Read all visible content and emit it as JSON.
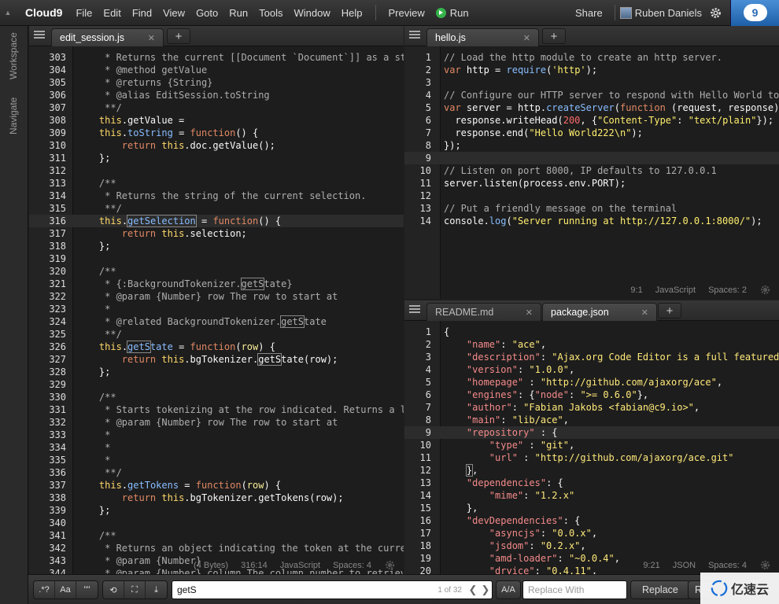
{
  "menubar": {
    "logo": "Cloud9",
    "menus": [
      "File",
      "Edit",
      "Find",
      "View",
      "Goto",
      "Run",
      "Tools",
      "Window",
      "Help"
    ],
    "preview": "Preview",
    "run": "Run",
    "share": "Share",
    "user": "Ruben Daniels",
    "badge": "9"
  },
  "sidebar": {
    "workspace": "Workspace",
    "navigate": "Navigate"
  },
  "left_pane": {
    "tab": "edit_session.js",
    "status": {
      "size": "(4 Bytes)",
      "pos": "316:14",
      "mode": "JavaScript",
      "spaces": "Spaces: 4"
    },
    "lines": [
      {
        "n": "303",
        "h": "<span class=\"c-com\">     * Returns the current [[Document `Document`]] as a string.</span>"
      },
      {
        "n": "304",
        "h": "<span class=\"c-com\">     * @method getValue</span>"
      },
      {
        "n": "305",
        "h": "<span class=\"c-com\">     * @returns {String}</span>"
      },
      {
        "n": "306",
        "h": "<span class=\"c-com\">     * @alias EditSession.toString</span>"
      },
      {
        "n": "307",
        "h": "<span class=\"c-com\">     **/</span>"
      },
      {
        "n": "308",
        "h": "    <span class=\"c-this\">this</span><span class=\"c-plain\">.getValue =</span>"
      },
      {
        "n": "309",
        "h": "    <span class=\"c-this\">this</span><span class=\"c-plain\">.</span><span class=\"c-fn\">toString</span><span class=\"c-plain\"> = </span><span class=\"c-kw\">function</span><span class=\"c-plain\">() {</span>"
      },
      {
        "n": "310",
        "h": "        <span class=\"c-kw\">return</span> <span class=\"c-this\">this</span><span class=\"c-plain\">.doc.getValue();</span>"
      },
      {
        "n": "311",
        "h": "    <span class=\"c-plain\">};</span>"
      },
      {
        "n": "312",
        "h": ""
      },
      {
        "n": "313",
        "h": "<span class=\"c-com\">    /**</span>"
      },
      {
        "n": "314",
        "h": "<span class=\"c-com\">     * Returns the string of the current selection.</span>"
      },
      {
        "n": "315",
        "h": "<span class=\"c-com\">     **/</span>"
      },
      {
        "n": "316",
        "hl": true,
        "h": "    <span class=\"c-this\">this</span><span class=\"c-plain\">.</span><span class=\"c-fn box\">getSelection</span><span class=\"c-plain\"> = </span><span class=\"c-kw\">function</span><span class=\"c-plain\">() {</span>"
      },
      {
        "n": "317",
        "h": "        <span class=\"c-kw\">return</span> <span class=\"c-this\">this</span><span class=\"c-plain\">.selection;</span>"
      },
      {
        "n": "318",
        "h": "    <span class=\"c-plain\">};</span>"
      },
      {
        "n": "319",
        "h": ""
      },
      {
        "n": "320",
        "h": "<span class=\"c-com\">    /**</span>"
      },
      {
        "n": "321",
        "h": "<span class=\"c-com\">     * {:BackgroundTokenizer.<span class=\"box\">getS</span>tate}</span>"
      },
      {
        "n": "322",
        "h": "<span class=\"c-com\">     * @param {Number} row The row to start at</span>"
      },
      {
        "n": "323",
        "h": "<span class=\"c-com\">     *</span>"
      },
      {
        "n": "324",
        "h": "<span class=\"c-com\">     * @related BackgroundTokenizer.<span class=\"box\">getS</span>tate</span>"
      },
      {
        "n": "325",
        "h": "<span class=\"c-com\">     **/</span>"
      },
      {
        "n": "326",
        "h": "    <span class=\"c-this\">this</span><span class=\"c-plain\">.</span><span class=\"c-fn box\">getS</span><span class=\"c-fn\">tate</span><span class=\"c-plain\"> = </span><span class=\"c-kw\">function</span><span class=\"c-plain\">(</span><span class=\"c-key\">row</span><span class=\"c-plain\">) {</span>"
      },
      {
        "n": "327",
        "h": "        <span class=\"c-kw\">return</span> <span class=\"c-this\">this</span><span class=\"c-plain\">.bgTokenizer.</span><span class=\"c-plain box\">getS</span><span class=\"c-plain\">tate(row);</span>"
      },
      {
        "n": "328",
        "h": "    <span class=\"c-plain\">};</span>"
      },
      {
        "n": "329",
        "h": ""
      },
      {
        "n": "330",
        "h": "<span class=\"c-com\">    /**</span>"
      },
      {
        "n": "331",
        "h": "<span class=\"c-com\">     * Starts tokenizing at the row indicated. Returns a list of</span>"
      },
      {
        "n": "332",
        "h": "<span class=\"c-com\">     * @param {Number} row The row to start at</span>"
      },
      {
        "n": "333",
        "h": "<span class=\"c-com\">     *</span>"
      },
      {
        "n": "334",
        "h": "<span class=\"c-com\">     *</span>"
      },
      {
        "n": "335",
        "h": "<span class=\"c-com\">     *</span>"
      },
      {
        "n": "336",
        "h": "<span class=\"c-com\">     **/</span>"
      },
      {
        "n": "337",
        "h": "    <span class=\"c-this\">this</span><span class=\"c-plain\">.</span><span class=\"c-fn\">getTokens</span><span class=\"c-plain\"> = </span><span class=\"c-kw\">function</span><span class=\"c-plain\">(</span><span class=\"c-key\">row</span><span class=\"c-plain\">) {</span>"
      },
      {
        "n": "338",
        "h": "        <span class=\"c-kw\">return</span> <span class=\"c-this\">this</span><span class=\"c-plain\">.bgTokenizer.getTokens(row);</span>"
      },
      {
        "n": "339",
        "h": "    <span class=\"c-plain\">};</span>"
      },
      {
        "n": "340",
        "h": ""
      },
      {
        "n": "341",
        "h": "<span class=\"c-com\">    /**</span>"
      },
      {
        "n": "342",
        "h": "<span class=\"c-com\">     * Returns an object indicating the token at the current row.</span>"
      },
      {
        "n": "343",
        "h": "<span class=\"c-com\">     * @param {Number}</span>"
      },
      {
        "n": "344",
        "h": "<span class=\"c-com\">     * @param {Number} column The column number to retrieve</span>"
      }
    ]
  },
  "right_top": {
    "tab": "hello.js",
    "status": {
      "pos": "9:1",
      "mode": "JavaScript",
      "spaces": "Spaces: 2"
    },
    "lines": [
      {
        "n": "1",
        "h": "<span class=\"c-com\">// Load the http module to create an http server.</span>"
      },
      {
        "n": "2",
        "h": "<span class=\"c-kw\">var</span> <span class=\"c-plain\">http = </span><span class=\"c-fn\">require</span><span class=\"c-plain\">(</span><span class=\"c-str\">'http'</span><span class=\"c-plain\">);</span>"
      },
      {
        "n": "3",
        "h": ""
      },
      {
        "n": "4",
        "h": "<span class=\"c-com\">// Configure our HTTP server to respond with Hello World to all requests.</span>"
      },
      {
        "n": "5",
        "h": "<span class=\"c-kw\">var</span> <span class=\"c-plain\">server = http.</span><span class=\"c-fn\">createServer</span><span class=\"c-plain\">(</span><span class=\"c-kw\">function</span><span class=\"c-plain\"> (request, response) {</span>"
      },
      {
        "n": "6",
        "h": "  <span class=\"c-plain\">response.writeHead(</span><span class=\"c-num\">200</span><span class=\"c-plain\">, {</span><span class=\"c-str\">\"Content-Type\"</span><span class=\"c-plain\">: </span><span class=\"c-str\">\"text/plain\"</span><span class=\"c-plain\">});</span>"
      },
      {
        "n": "7",
        "h": "  <span class=\"c-plain\">response.end(</span><span class=\"c-str\">\"Hello World222\\n\"</span><span class=\"c-plain\">);</span>"
      },
      {
        "n": "8",
        "h": "<span class=\"c-plain\">});</span>"
      },
      {
        "n": "9",
        "hl": true,
        "h": ""
      },
      {
        "n": "10",
        "h": "<span class=\"c-com\">// Listen on port 8000, IP defaults to 127.0.0.1</span>"
      },
      {
        "n": "11",
        "h": "<span class=\"c-plain\">server.listen(process.env.PORT);</span>"
      },
      {
        "n": "12",
        "h": ""
      },
      {
        "n": "13",
        "h": "<span class=\"c-com\">// Put a friendly message on the terminal</span>"
      },
      {
        "n": "14",
        "h": "<span class=\"c-plain\">console.</span><span class=\"c-fn\">log</span><span class=\"c-plain\">(</span><span class=\"c-str\">\"Server running at http://127.0.0.1:8000/\"</span><span class=\"c-plain\">);</span>"
      }
    ]
  },
  "right_bottom": {
    "tabs": [
      "README.md",
      "package.json"
    ],
    "status": {
      "pos": "9:21",
      "mode": "JSON",
      "spaces": "Spaces: 4"
    },
    "lines": [
      {
        "n": "1",
        "h": "<span class=\"c-plain\">{</span>"
      },
      {
        "n": "2",
        "h": "    <span class=\"c-json-key\">\"name\"</span><span class=\"c-plain\">: </span><span class=\"c-json-val\">\"ace\"</span><span class=\"c-plain\">,</span>"
      },
      {
        "n": "3",
        "h": "    <span class=\"c-json-key\">\"description\"</span><span class=\"c-plain\">: </span><span class=\"c-json-val\">\"Ajax.org Code Editor is a full featured source code editor\"</span>"
      },
      {
        "n": "4",
        "h": "    <span class=\"c-json-key\">\"version\"</span><span class=\"c-plain\">: </span><span class=\"c-json-val\">\"1.0.0\"</span><span class=\"c-plain\">,</span>"
      },
      {
        "n": "5",
        "h": "    <span class=\"c-json-key\">\"homepage\"</span><span class=\"c-plain\"> : </span><span class=\"c-json-val\">\"http://github.com/ajaxorg/ace\"</span><span class=\"c-plain\">,</span>"
      },
      {
        "n": "6",
        "h": "    <span class=\"c-json-key\">\"engines\"</span><span class=\"c-plain\">: {</span><span class=\"c-json-key\">\"node\"</span><span class=\"c-plain\">: </span><span class=\"c-json-val\">\">= 0.6.0\"</span><span class=\"c-plain\">},</span>"
      },
      {
        "n": "7",
        "h": "    <span class=\"c-json-key\">\"author\"</span><span class=\"c-plain\">: </span><span class=\"c-json-val\">\"Fabian Jakobs &lt;fabian@c9.io&gt;\"</span><span class=\"c-plain\">,</span>"
      },
      {
        "n": "8",
        "h": "    <span class=\"c-json-key\">\"main\"</span><span class=\"c-plain\">: </span><span class=\"c-json-val\">\"lib/ace\"</span><span class=\"c-plain\">,</span>"
      },
      {
        "n": "9",
        "hl": true,
        "h": "    <span class=\"c-json-key\">\"repository\"</span><span class=\"c-plain\"> : {</span>"
      },
      {
        "n": "10",
        "h": "        <span class=\"c-json-key\">\"type\"</span><span class=\"c-plain\"> : </span><span class=\"c-json-val\">\"git\"</span><span class=\"c-plain\">,</span>"
      },
      {
        "n": "11",
        "h": "        <span class=\"c-json-key\">\"url\"</span><span class=\"c-plain\"> : </span><span class=\"c-json-val\">\"http://github.com/ajaxorg/ace.git\"</span>"
      },
      {
        "n": "12",
        "h": "    <span class=\"c-plain box\">}</span><span class=\"c-plain\">,</span>"
      },
      {
        "n": "13",
        "h": "    <span class=\"c-json-key\">\"dependencies\"</span><span class=\"c-plain\">: {</span>"
      },
      {
        "n": "14",
        "h": "        <span class=\"c-json-key\">\"mime\"</span><span class=\"c-plain\">: </span><span class=\"c-json-val\">\"1.2.x\"</span>"
      },
      {
        "n": "15",
        "h": "    <span class=\"c-plain\">},</span>"
      },
      {
        "n": "16",
        "h": "    <span class=\"c-json-key\">\"devDependencies\"</span><span class=\"c-plain\">: {</span>"
      },
      {
        "n": "17",
        "h": "        <span class=\"c-json-key\">\"asyncjs\"</span><span class=\"c-plain\">: </span><span class=\"c-json-val\">\"0.0.x\"</span><span class=\"c-plain\">,</span>"
      },
      {
        "n": "18",
        "h": "        <span class=\"c-json-key\">\"jsdom\"</span><span class=\"c-plain\">: </span><span class=\"c-json-val\">\"0.2.x\"</span><span class=\"c-plain\">,</span>"
      },
      {
        "n": "19",
        "h": "        <span class=\"c-json-key\">\"amd-loader\"</span><span class=\"c-plain\">: </span><span class=\"c-json-val\">\"~0.0.4\"</span><span class=\"c-plain\">,</span>"
      },
      {
        "n": "20",
        "h": "        <span class=\"c-json-key\">\"dryice\"</span><span class=\"c-plain\">: </span><span class=\"c-json-val\">\"0.4.11\"</span><span class=\"c-plain\">,</span>"
      }
    ]
  },
  "searchbar": {
    "query": "getS",
    "count": "1 of 32",
    "replace_placeholder": "Replace With",
    "replace_label": "Replace",
    "replace_all_label": "R",
    "btn_regex": ".*?",
    "btn_case": "Aa",
    "btn_word": "\"\"",
    "btn_case_toggle": "A/A"
  },
  "watermark": "亿速云"
}
